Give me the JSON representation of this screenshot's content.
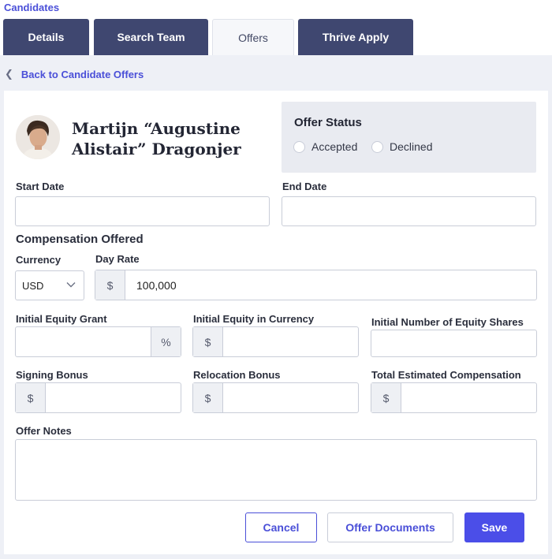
{
  "breadcrumb": "Candidates",
  "tabs": [
    {
      "label": "Details"
    },
    {
      "label": "Search Team"
    },
    {
      "label": "Offers"
    },
    {
      "label": "Thrive Apply"
    }
  ],
  "back_link": "Back to Candidate Offers",
  "candidate": {
    "name_line1": "Martijn “Augustine",
    "name_line2": "Alistair” Dragonjer"
  },
  "offer_status": {
    "title": "Offer Status",
    "options": [
      "Accepted",
      "Declined"
    ]
  },
  "dates": {
    "start_label": "Start Date",
    "start_value": "",
    "end_label": "End Date",
    "end_value": ""
  },
  "compensation": {
    "section_title": "Compensation Offered",
    "currency_label": "Currency",
    "currency_value": "USD",
    "day_rate_label": "Day Rate",
    "day_rate_symbol": "$",
    "day_rate_value": "100,000",
    "equity_grant_label": "Initial Equity Grant",
    "equity_grant_symbol": "%",
    "equity_currency_label": "Initial Equity in Currency",
    "equity_currency_symbol": "$",
    "equity_shares_label": "Initial Number of Equity Shares",
    "signing_label": "Signing Bonus",
    "signing_symbol": "$",
    "relocation_label": "Relocation Bonus",
    "relocation_symbol": "$",
    "total_label": "Total Estimated Compensation",
    "total_symbol": "$"
  },
  "notes": {
    "label": "Offer Notes",
    "value": ""
  },
  "actions": {
    "cancel": "Cancel",
    "documents": "Offer Documents",
    "save": "Save"
  },
  "colors": {
    "accent": "#4a4fd8",
    "tab_bg": "#3f4770",
    "primary_button": "#4b4ee8"
  }
}
